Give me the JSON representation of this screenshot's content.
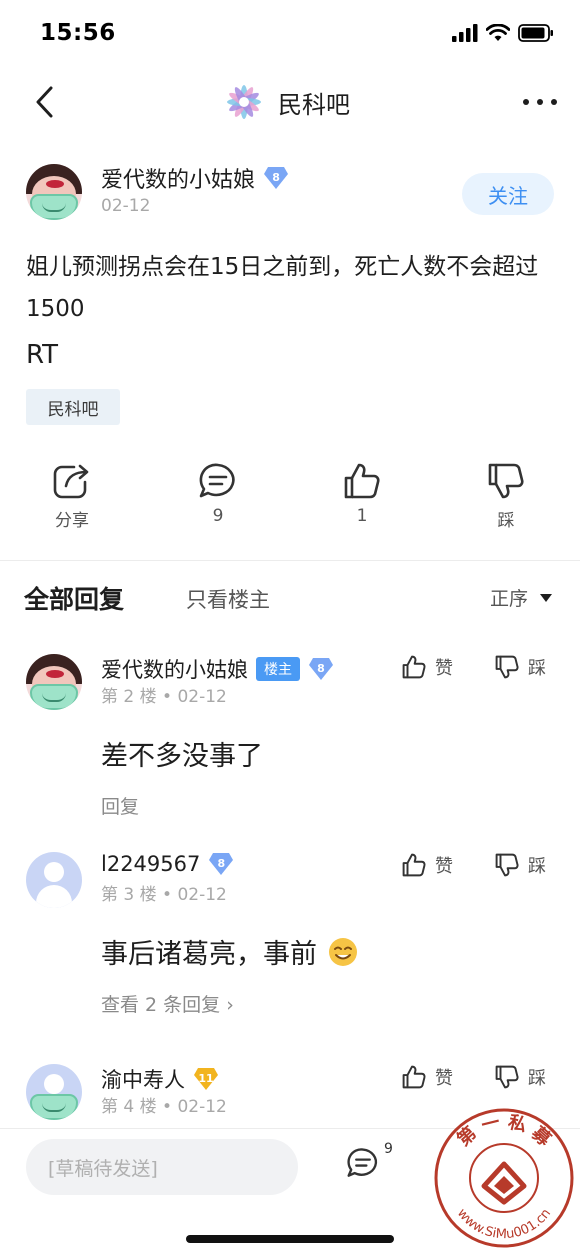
{
  "status_bar": {
    "time": "15:56"
  },
  "nav": {
    "title": "民科吧"
  },
  "post": {
    "author": "爱代数的小姑娘",
    "author_level": "8",
    "date": "02-12",
    "follow_label": "关注",
    "title": "姐儿预测拐点会在15日之前到，死亡人数不会超过1500",
    "body": "RT",
    "bar_tag": "民科吧"
  },
  "actions": {
    "share_label": "分享",
    "comment_count": "9",
    "like_count": "1",
    "dislike_label": "踩"
  },
  "sort_bar": {
    "tab_all": "全部回复",
    "tab_owner": "只看楼主",
    "sort_label": "正序"
  },
  "comments": [
    {
      "author": "爱代数的小姑娘",
      "owner_tag": "楼主",
      "level": "8",
      "meta": "第 2 楼 • 02-12",
      "like_label": "赞",
      "dislike_label": "踩",
      "text": "差不多没事了",
      "reply_label": "回复"
    },
    {
      "author": "l2249567",
      "level": "8",
      "meta": "第 3 楼 • 02-12",
      "like_label": "赞",
      "dislike_label": "踩",
      "text": "事后诸葛亮，事前",
      "reply_label": "查看 2 条回复 ›"
    },
    {
      "author": "渝中寿人",
      "level": "11",
      "meta": "第 4 楼 • 02-12",
      "like_label": "赞",
      "dislike_label": "踩"
    }
  ],
  "bottom_bar": {
    "draft_placeholder": "[草稿待发送]",
    "comment_count": "9"
  },
  "watermark": {
    "text_top": "第 一 私 募",
    "text_bottom": "www.SiMu001.cn"
  },
  "colors": {
    "accent_blue": "#3d8ff2",
    "follow_bg": "#e8f3fe",
    "owner_tag": "#4a9af4",
    "level_badge": "#7aa6f5",
    "gold_badge": "#f2b41f",
    "watermark_red": "#b73a2a"
  }
}
